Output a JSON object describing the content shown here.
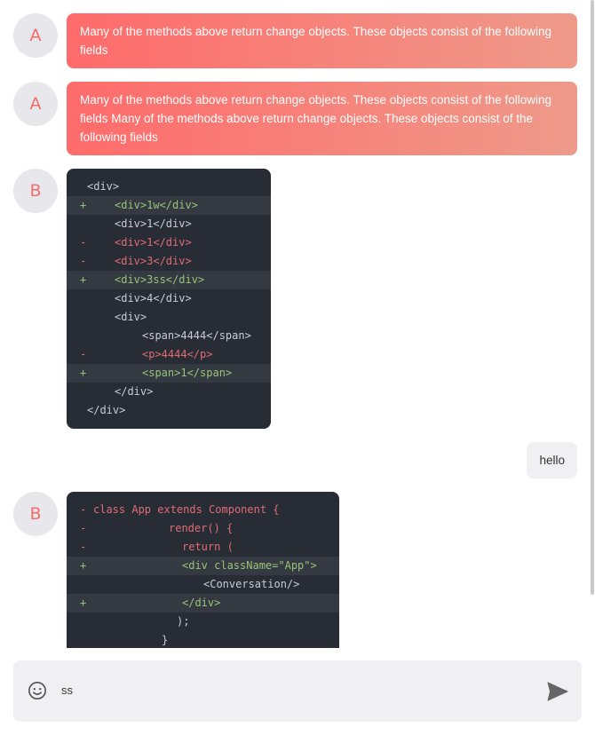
{
  "messages": [
    {
      "avatar": "A",
      "text": "Many of the methods above return change objects. These objects consist of the following fields"
    },
    {
      "avatar": "A",
      "text": "Many of the methods above return change objects. These objects consist of the following fields Many of the methods above return change objects. These objects consist of the following fields"
    }
  ],
  "diff1": {
    "avatar": "B",
    "lines": [
      {
        "sign": "",
        "code": "<div>",
        "type": "ctx",
        "indent": 0
      },
      {
        "sign": "+",
        "code": "<div>1w</div>",
        "type": "add",
        "indent": 1
      },
      {
        "sign": "",
        "code": "<div>1</div>",
        "type": "ctx",
        "indent": 1
      },
      {
        "sign": "-",
        "code": "<div>1</div>",
        "type": "del",
        "indent": 1
      },
      {
        "sign": "-",
        "code": "<div>3</div>",
        "type": "del",
        "indent": 1
      },
      {
        "sign": "+",
        "code": "<div>3ss</div>",
        "type": "add",
        "indent": 1
      },
      {
        "sign": "",
        "code": "<div>4</div>",
        "type": "ctx",
        "indent": 1
      },
      {
        "sign": "",
        "code": "<div>",
        "type": "ctx",
        "indent": 1
      },
      {
        "sign": "",
        "code": "<span>4444</span>",
        "type": "ctx",
        "indent": 2
      },
      {
        "sign": "-",
        "code": "<p>4444</p>",
        "type": "del",
        "indent": 2
      },
      {
        "sign": "+",
        "code": "<span>1</span>",
        "type": "add",
        "indent": 2
      },
      {
        "sign": "",
        "code": "</div>",
        "type": "ctx",
        "indent": 1
      },
      {
        "sign": "",
        "code": "</div>",
        "type": "ctx",
        "indent": 0
      }
    ]
  },
  "user_message": {
    "text": "hello"
  },
  "diff2": {
    "avatar": "B",
    "lines": [
      {
        "sign": "-",
        "code": "class App extends Component {",
        "type": "del",
        "indent": 0
      },
      {
        "sign": "-",
        "code": "render() {",
        "type": "del",
        "indent": 1
      },
      {
        "sign": "-",
        "code": "return (",
        "type": "del",
        "indent": 2
      },
      {
        "sign": "+",
        "code": "<div className=\"App\">",
        "type": "add",
        "indent": 2
      },
      {
        "sign": "",
        "code": "<Conversation/>",
        "type": "ctx",
        "indent": 3
      },
      {
        "sign": "+",
        "code": "</div>",
        "type": "add",
        "indent": 2
      },
      {
        "sign": "",
        "code": ");",
        "type": "ctx",
        "indent": 4
      },
      {
        "sign": "",
        "code": "}",
        "type": "ctx",
        "indent": 5
      }
    ]
  },
  "input": {
    "value": "ss",
    "emoji_icon": "smile-icon",
    "send_icon": "send-icon"
  },
  "colors": {
    "accent": "#f56c6c",
    "add": "#98c379",
    "del": "#e06c75",
    "code_bg": "#282c34"
  }
}
